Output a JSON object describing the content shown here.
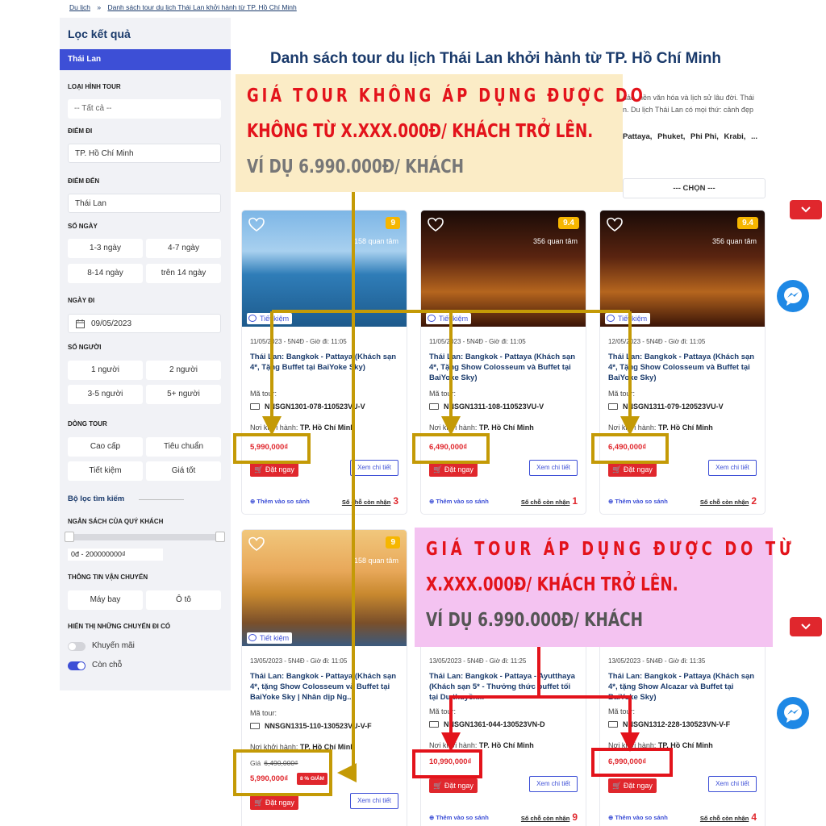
{
  "breadcrumb": {
    "home": "Du lịch",
    "sep": "»",
    "current": "Danh sách tour du lịch Thái Lan khởi hành từ TP. Hồ Chí Minh"
  },
  "sidebar": {
    "title": "Lọc kết quả",
    "active": "Thái Lan",
    "tour_type_label": "LOẠI HÌNH TOUR",
    "tour_type_value": "-- Tất cả --",
    "from_label": "ĐIỂM ĐI",
    "from_value": "TP. Hồ Chí Minh",
    "to_label": "ĐIỂM ĐẾN",
    "to_value": "Thái Lan",
    "days_label": "SỐ NGÀY",
    "days": [
      "1-3 ngày",
      "4-7 ngày",
      "8-14 ngày",
      "trên 14 ngày"
    ],
    "date_label": "NGÀY ĐI",
    "date_value": "09/05/2023",
    "people_label": "SỐ NGƯỜI",
    "people": [
      "1 người",
      "2 người",
      "3-5 người",
      "5+ người"
    ],
    "line_label": "DÒNG TOUR",
    "lines": [
      "Cao cấp",
      "Tiêu chuẩn",
      "Tiết kiệm",
      "Giá tốt"
    ],
    "search_filter": "Bộ lọc tìm kiếm",
    "budget_label": "NGÂN SÁCH CỦA QUÝ KHÁCH",
    "budget_value": "0đ - 200000000₫",
    "transport_label": "THÔNG TIN VẬN CHUYỂN",
    "transport": [
      "Máy bay",
      "Ô tô"
    ],
    "show_label": "HIỂN THỊ NHỮNG CHUYẾN ĐI CÓ",
    "toggle_promo": "Khuyến mãi",
    "toggle_seats": "Còn chỗ"
  },
  "main": {
    "title": "Danh sách tour du lịch Thái Lan khởi hành từ TP. Hồ Chí Minh",
    "intro_1": "đảo, nền văn hóa và lịch sử lâu đời. Thái",
    "intro_2": "n. Du lịch Thái Lan có mọi thứ: cảnh đẹp",
    "destinations": [
      "Pattaya,",
      "Phuket,",
      "Phi Phi,",
      "Krabi,",
      "..."
    ],
    "sort_label": "--- CHỌN ---"
  },
  "cards": [
    {
      "score": "9",
      "reviews": "158 quan tâm",
      "tag": "Tiết kiệm",
      "date": "11/05/2023 - 5N4Đ - Giờ đi: 11:05",
      "name": "Thái Lan: Bangkok - Pattaya (Khách sạn 4*, Tặng Buffet tại BaiYoke Sky)",
      "code_label": "Mã tour:",
      "code": "NNSGN1301-078-110523VU-V",
      "from_label": "Nơi khởi hành:",
      "from": "TP. Hồ Chí Minh",
      "old_label": "",
      "old_price": "",
      "price": "5,990,000₫",
      "discount": "",
      "book": "Đặt ngay",
      "detail": "Xem chi tiết",
      "compare": "Thêm vào so sánh",
      "seats_label": "Số chỗ còn nhận",
      "seats": "3"
    },
    {
      "score": "9.4",
      "reviews": "356 quan tâm",
      "tag": "Tiết kiệm",
      "date": "11/05/2023 - 5N4Đ - Giờ đi: 11:05",
      "name": "Thái Lan: Bangkok - Pattaya (Khách sạn 4*, Tặng Show Colosseum và Buffet tại BaiYoke Sky)",
      "code_label": "Mã tour:",
      "code": "NNSGN1311-108-110523VU-V",
      "from_label": "Nơi khởi hành:",
      "from": "TP. Hồ Chí Minh",
      "old_label": "",
      "old_price": "",
      "price": "6,490,000₫",
      "discount": "",
      "book": "Đặt ngay",
      "detail": "Xem chi tiết",
      "compare": "Thêm vào so sánh",
      "seats_label": "Số chỗ còn nhận",
      "seats": "1"
    },
    {
      "score": "9.4",
      "reviews": "356 quan tâm",
      "tag": "Tiết kiệm",
      "date": "12/05/2023 - 5N4Đ - Giờ đi: 11:05",
      "name": "Thái Lan: Bangkok - Pattaya (Khách sạn 4*, Tặng Show Colosseum và Buffet tại BaiYoke Sky)",
      "code_label": "Mã tour:",
      "code": "NNSGN1311-079-120523VU-V",
      "from_label": "Nơi khởi hành:",
      "from": "TP. Hồ Chí Minh",
      "old_label": "",
      "old_price": "",
      "price": "6,490,000₫",
      "discount": "",
      "book": "Đặt ngay",
      "detail": "Xem chi tiết",
      "compare": "Thêm vào so sánh",
      "seats_label": "Số chỗ còn nhận",
      "seats": "2"
    },
    {
      "score": "9",
      "reviews": "158 quan tâm",
      "tag": "Tiết kiệm",
      "date": "13/05/2023 - 5N4Đ - Giờ đi: 11:05",
      "name": "Thái Lan: Bangkok - Pattaya (Khách sạn 4*, tặng Show Colosseum và Buffet tại BaiYoke Sky | Nhân dịp Ng...",
      "code_label": "Mã tour:",
      "code": "NNSGN1315-110-130523VU-V-F",
      "from_label": "Nơi khởi hành:",
      "from": "TP. Hồ Chí Minh",
      "old_label": "Giá",
      "old_price": "6,490,000₫",
      "price": "5,990,000₫",
      "discount": "8 % GIẢM",
      "book": "Đặt ngay",
      "detail": "Xem chi tiết",
      "compare": "",
      "seats_label": "",
      "seats": ""
    },
    {
      "score": "",
      "reviews": "",
      "tag": "",
      "date": "13/05/2023 - 5N4Đ - Giờ đi: 11:25",
      "name": "Thái Lan: Bangkok - Pattaya - Ayutthaya (Khách sạn 5* - Thưởng thức buffet tối tại Du thuyền...",
      "code_label": "Mã tour:",
      "code": "NNSGN1361-044-130523VN-D",
      "from_label": "Nơi khởi hành:",
      "from": "TP. Hồ Chí Minh",
      "old_label": "",
      "old_price": "",
      "price": "10,990,000₫",
      "discount": "",
      "book": "Đặt ngay",
      "detail": "Xem chi tiết",
      "compare": "Thêm vào so sánh",
      "seats_label": "Số chỗ còn nhận",
      "seats": "9"
    },
    {
      "score": "",
      "reviews": "",
      "tag": "",
      "date": "13/05/2023 - 5N4Đ - Giờ đi: 11:35",
      "name": "Thái Lan: Bangkok - Pattaya (Khách sạn 4*, tặng Show Alcazar và Buffet tại BaiYoke Sky)",
      "code_label": "Mã tour:",
      "code": "NNSGN1312-228-130523VN-V-F",
      "from_label": "Nơi khởi hành:",
      "from": "TP. Hồ Chí Minh",
      "old_label": "",
      "old_price": "",
      "price": "6,990,000₫",
      "discount": "",
      "book": "Đặt ngay",
      "detail": "Xem chi tiết",
      "compare": "Thêm vào so sánh",
      "seats_label": "Số chỗ còn nhận",
      "seats": "4"
    }
  ],
  "annotations": {
    "yellow": [
      "GIÁ TOUR KHÔNG ÁP DỤNG ĐƯỢC DO",
      "KHÔNG TỪ X.XXX.000Đ/ KHÁCH TRỞ LÊN.",
      "VÍ DỤ 6.990.000Đ/ KHÁCH"
    ],
    "pink": [
      "GIÁ TOUR ÁP DỤNG ĐƯỢC DO TỪ",
      "X.XXX.000Đ/ KHÁCH TRỞ LÊN.",
      "VÍ DỤ 6.990.000Đ/ KHÁCH"
    ]
  },
  "colors": {
    "accent": "#3d4fd6",
    "price_red": "#e0272d",
    "navy": "#1a3a6b",
    "annot_gold": "#c49a06",
    "annot_red": "#e3131b"
  }
}
